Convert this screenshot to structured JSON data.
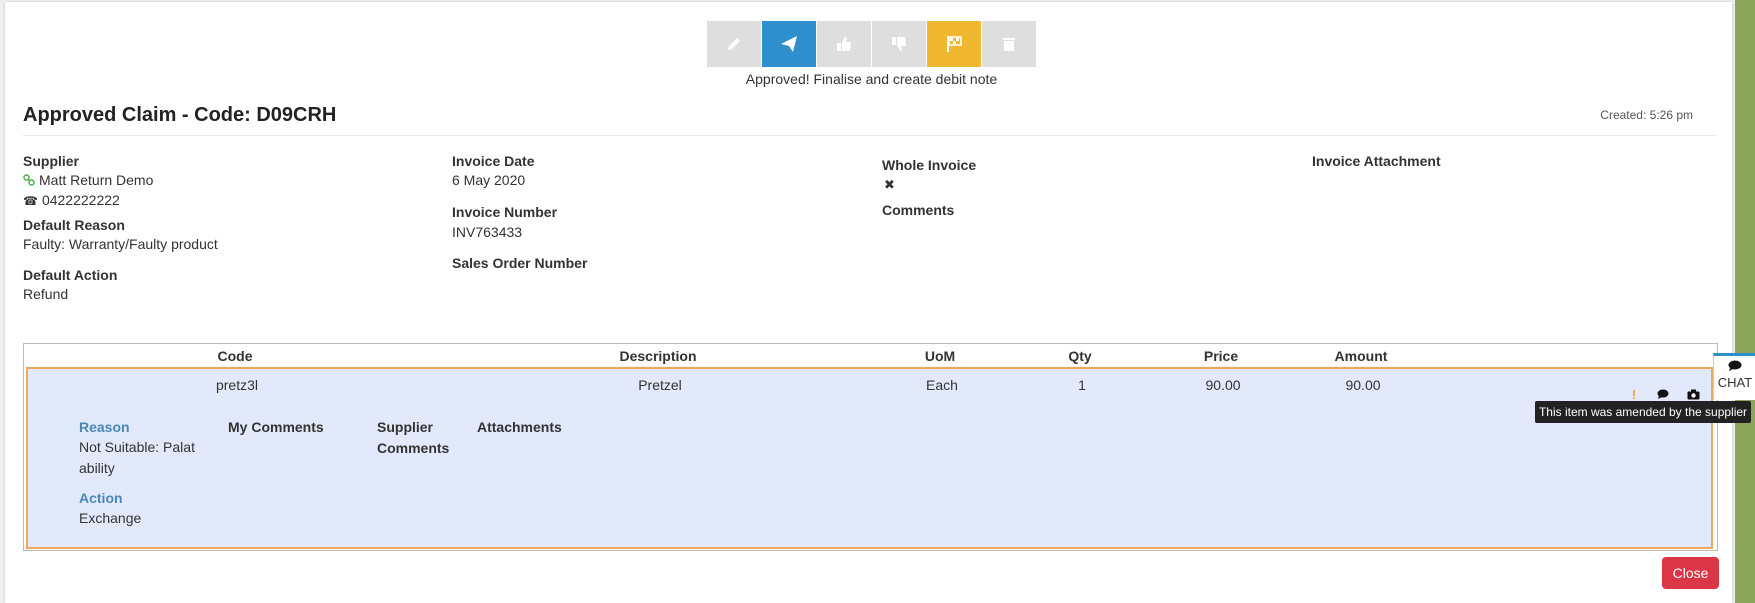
{
  "status_message": "Approved! Finalise and create debit note",
  "toolbar_icons": [
    "pencil-icon",
    "send-icon",
    "thumbs-up-icon",
    "thumbs-down-icon",
    "finish-flag-icon",
    "trash-icon"
  ],
  "header": {
    "title": "Approved Claim - Code: D09CRH",
    "created": "Created: 5:26 pm"
  },
  "details": {
    "supplier_label": "Supplier",
    "supplier_name": "Matt Return Demo",
    "supplier_phone": "0422222222",
    "default_reason_label": "Default Reason",
    "default_reason": "Faulty: Warranty/Faulty product",
    "default_action_label": "Default Action",
    "default_action": "Refund",
    "invoice_date_label": "Invoice Date",
    "invoice_date": "6 May 2020",
    "invoice_number_label": "Invoice Number",
    "invoice_number": "INV763433",
    "sales_order_label": "Sales Order Number",
    "whole_invoice_label": "Whole Invoice",
    "whole_invoice_value": "✖",
    "comments_label": "Comments",
    "invoice_attachment_label": "Invoice Attachment"
  },
  "table": {
    "headers": {
      "code": "Code",
      "description": "Description",
      "uom": "UoM",
      "qty": "Qty",
      "price": "Price",
      "amount": "Amount"
    },
    "row": {
      "code": "pretz3l",
      "description": "Pretzel",
      "uom": "Each",
      "qty": "1",
      "price": "90.00",
      "amount": "90.00",
      "reason_label": "Reason",
      "reason_line1": "Not Suitable: Palat",
      "reason_line2": "ability",
      "action_label": "Action",
      "action": "Exchange",
      "my_comments_label": "My Comments",
      "supplier_comments_line1": "Supplier",
      "supplier_comments_line2": "Comments",
      "attachments_label": "Attachments",
      "amended_icon": "!"
    }
  },
  "tooltip": "This item was amended by the supplier",
  "chat_label": "CHAT",
  "close_label": "Close",
  "colors": {
    "blue": "#2f8fcc",
    "yellow": "#f0b830",
    "red": "#dc3545",
    "row_bg": "#e2e9fa",
    "row_border": "#f0a858"
  }
}
